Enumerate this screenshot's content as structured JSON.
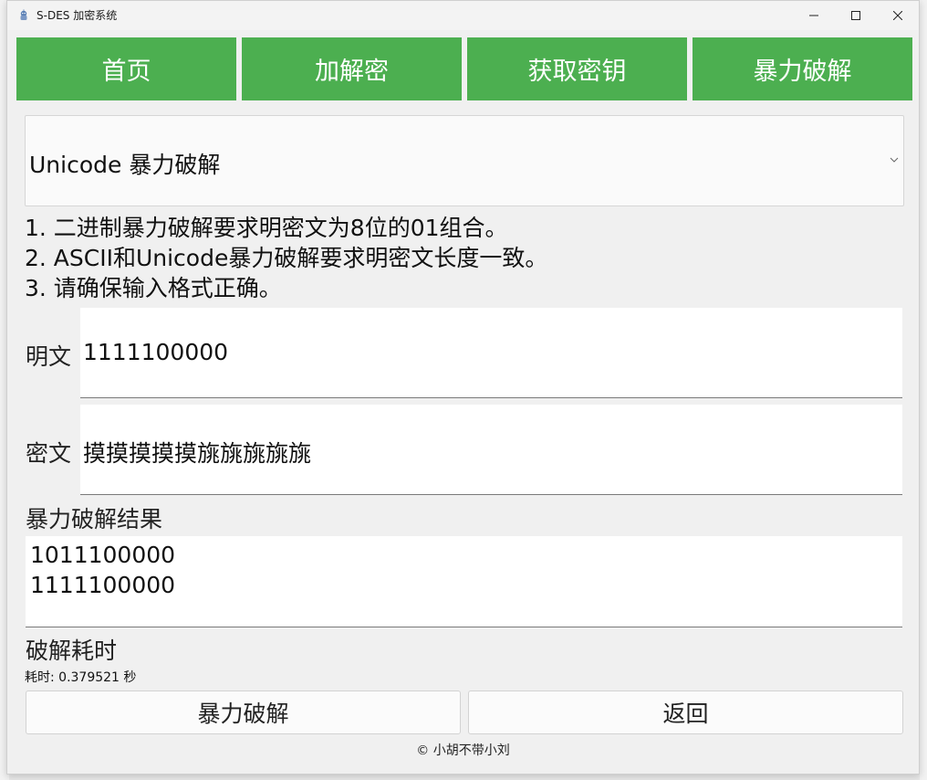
{
  "window": {
    "title": "S-DES 加密系统",
    "icon": "python-app-icon",
    "controls": [
      "minimize-icon",
      "maximize-icon",
      "close-icon"
    ]
  },
  "nav": {
    "items": [
      {
        "label": "首页"
      },
      {
        "label": "加解密"
      },
      {
        "label": "获取密钥"
      },
      {
        "label": "暴力破解"
      }
    ],
    "accent_color": "#4caf50"
  },
  "mode": {
    "selected": "Unicode 暴力破解"
  },
  "instructions": [
    "1. 二进制暴力破解要求明密文为8位的01组合。",
    "2. ASCII和Unicode暴力破解要求明密文长度一致。",
    "3. 请确保输入格式正确。"
  ],
  "plaintext": {
    "label": "明文",
    "value": "1111100000"
  },
  "ciphertext": {
    "label": "密文",
    "value": "摸摸摸摸摸旐旐旐旐旐"
  },
  "result": {
    "label": "暴力破解结果",
    "lines": [
      "1011100000",
      "1111100000"
    ]
  },
  "timing": {
    "label": "破解耗时",
    "value": "耗时: 0.379521 秒"
  },
  "actions": {
    "crack_label": "暴力破解",
    "back_label": "返回"
  },
  "footer": "© 小胡不带小刘"
}
